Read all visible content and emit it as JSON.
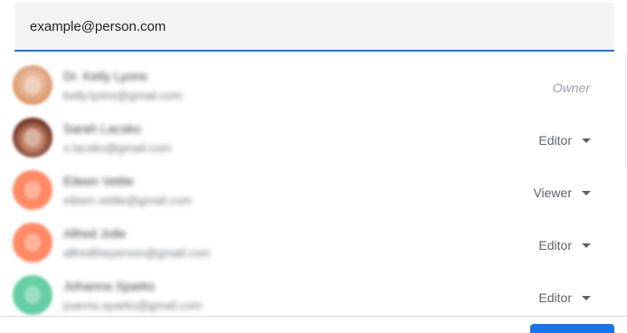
{
  "share_input": {
    "value": "example@person.com",
    "accent_color": "#1a73e8",
    "background_color": "#f1f3f4"
  },
  "people": [
    {
      "name": "Dr. Kelly Lyons",
      "email": "kelly.lyons@gmail.com",
      "avatar_icon": "person-photo-avatar",
      "avatar_color": "#d99565",
      "role": "Owner",
      "role_editable": false
    },
    {
      "name": "Sarah Lacsko",
      "email": "s.lacsko@gmail.com",
      "avatar_icon": "person-photo-avatar",
      "avatar_color": "#6b2e1c",
      "role": "Editor",
      "role_editable": true
    },
    {
      "name": "Eileen Vettle",
      "email": "eileen.vettle@gmail.com",
      "avatar_icon": "initial-avatar",
      "avatar_color": "#ff8a65",
      "role": "Viewer",
      "role_editable": true
    },
    {
      "name": "Alfred Jolle",
      "email": "alfredtheperson@gmail.com",
      "avatar_icon": "initial-avatar",
      "avatar_color": "#ff8a65",
      "role": "Editor",
      "role_editable": true
    },
    {
      "name": "Johanna Sparks",
      "email": "joanna.sparks@gmail.com",
      "avatar_icon": "initial-avatar",
      "avatar_color": "#66cfa3",
      "role": "Editor",
      "role_editable": true
    }
  ],
  "role_caret_icon": "caret-down-icon",
  "send_button_color": "#1a73e8"
}
